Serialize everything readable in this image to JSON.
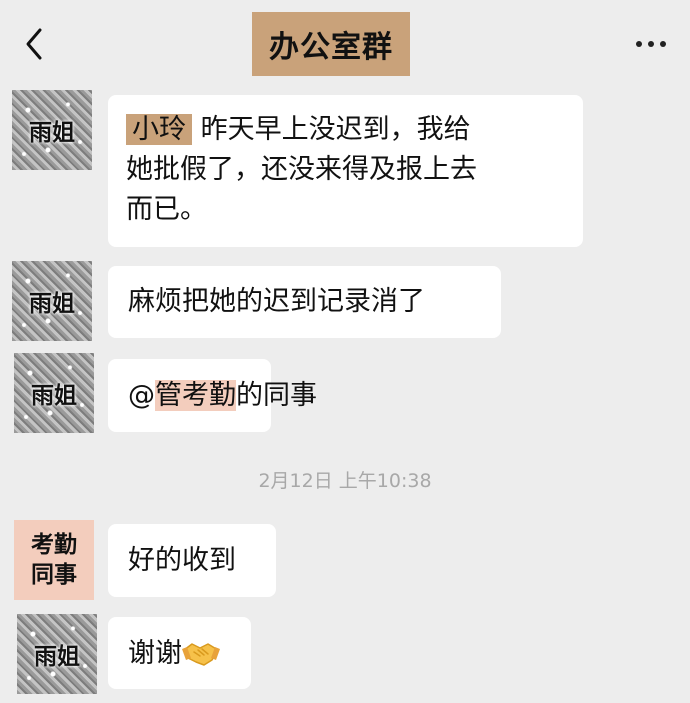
{
  "header": {
    "title": "办公室群"
  },
  "messages": {
    "m1": {
      "avatar_name": "雨姐",
      "mention": "小玲",
      "line1": "昨天早上没迟到，我给",
      "line2": "她批假了，还没来得及报上去",
      "line3": "而已。"
    },
    "m2": {
      "avatar_name": "雨姐",
      "text": "麻烦把她的迟到记录消了"
    },
    "m3": {
      "avatar_name": "雨姐",
      "at": "@",
      "mention": "管考勤",
      "rest": "的同事"
    },
    "timestamp": "2月12日 上午10:38",
    "m4": {
      "avatar_line1": "考勤",
      "avatar_line2": "同事",
      "text": "好的收到"
    },
    "m5": {
      "avatar_name": "雨姐",
      "text": "谢谢",
      "emoji": "handshake-emoji"
    }
  },
  "colors": {
    "background": "#ededed",
    "bubble": "#ffffff",
    "title_highlight": "#c9a27a",
    "mention_highlight_pink": "#f3cdbd",
    "timestamp": "#a8a8a8"
  }
}
